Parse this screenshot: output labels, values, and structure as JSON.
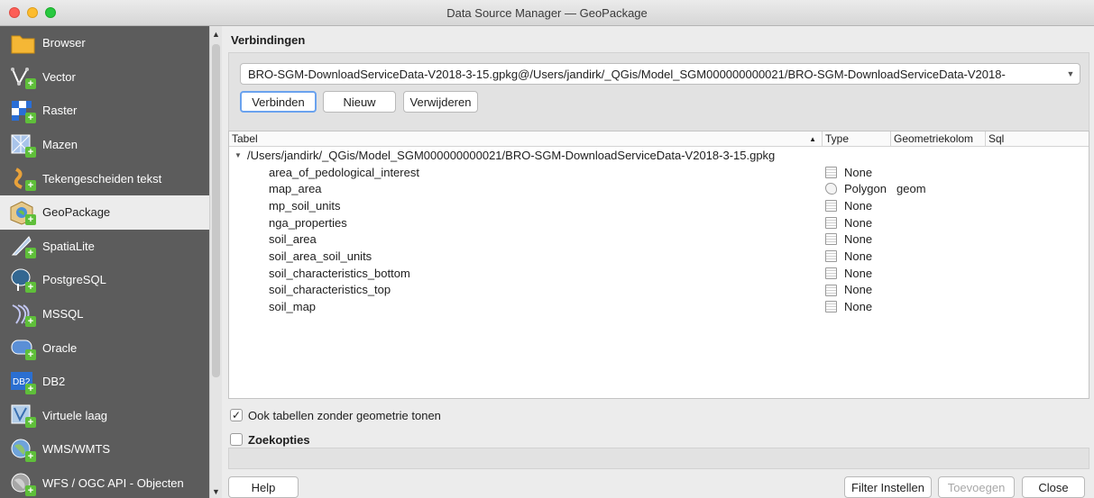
{
  "window": {
    "title": "Data Source Manager — GeoPackage"
  },
  "sidebar": {
    "items": [
      {
        "label": "Browser",
        "icon": "folder-icon"
      },
      {
        "label": "Vector",
        "icon": "vector-icon"
      },
      {
        "label": "Raster",
        "icon": "raster-icon"
      },
      {
        "label": "Mazen",
        "icon": "mesh-icon"
      },
      {
        "label": "Tekengescheiden tekst",
        "icon": "delimited-text-icon"
      },
      {
        "label": "GeoPackage",
        "icon": "geopackage-icon",
        "selected": true
      },
      {
        "label": "SpatiaLite",
        "icon": "spatialite-icon"
      },
      {
        "label": "PostgreSQL",
        "icon": "postgresql-icon"
      },
      {
        "label": "MSSQL",
        "icon": "mssql-icon"
      },
      {
        "label": "Oracle",
        "icon": "oracle-icon"
      },
      {
        "label": "DB2",
        "icon": "db2-icon"
      },
      {
        "label": "Virtuele laag",
        "icon": "virtual-layer-icon"
      },
      {
        "label": "WMS/WMTS",
        "icon": "wms-icon"
      },
      {
        "label": "WFS / OGC API - Objecten",
        "icon": "wfs-icon"
      }
    ]
  },
  "connections": {
    "heading": "Verbindingen",
    "selected_connection": "BRO-SGM-DownloadServiceData-V2018-3-15.gpkg@/Users/jandirk/_QGis/Model_SGM000000000021/BRO-SGM-DownloadServiceData-V2018-",
    "buttons": {
      "connect": "Verbinden",
      "new": "Nieuw",
      "remove": "Verwijderen"
    }
  },
  "table": {
    "columns": {
      "table": "Tabel",
      "type": "Type",
      "geometry_column": "Geometriekolom",
      "sql": "Sql"
    },
    "sort_indicator": "▲",
    "root": "/Users/jandirk/_QGis/Model_SGM000000000021/BRO-SGM-DownloadServiceData-V2018-3-15.gpkg",
    "rows": [
      {
        "name": "area_of_pedological_interest",
        "type": "None",
        "geom": "",
        "icon": "table-icon"
      },
      {
        "name": "map_area",
        "type": "Polygon",
        "geom": "geom",
        "icon": "polygon-icon"
      },
      {
        "name": "mp_soil_units",
        "type": "None",
        "geom": "",
        "icon": "table-icon"
      },
      {
        "name": "nga_properties",
        "type": "None",
        "geom": "",
        "icon": "table-icon"
      },
      {
        "name": "soil_area",
        "type": "None",
        "geom": "",
        "icon": "table-icon"
      },
      {
        "name": "soil_area_soil_units",
        "type": "None",
        "geom": "",
        "icon": "table-icon"
      },
      {
        "name": "soil_characteristics_bottom",
        "type": "None",
        "geom": "",
        "icon": "table-icon"
      },
      {
        "name": "soil_characteristics_top",
        "type": "None",
        "geom": "",
        "icon": "table-icon"
      },
      {
        "name": "soil_map",
        "type": "None",
        "geom": "",
        "icon": "table-icon"
      }
    ]
  },
  "options": {
    "show_no_geometry": {
      "label": "Ook tabellen zonder geometrie tonen",
      "checked": true
    },
    "search_options": {
      "label": "Zoekopties",
      "checked": false
    }
  },
  "footer": {
    "help": "Help",
    "filter": "Filter Instellen",
    "add": "Toevoegen",
    "close": "Close"
  },
  "colors": {
    "sidebar_bg": "#5c5c5c",
    "accent_plus": "#5fbf3a",
    "focus_ring": "#6aa2ee"
  }
}
